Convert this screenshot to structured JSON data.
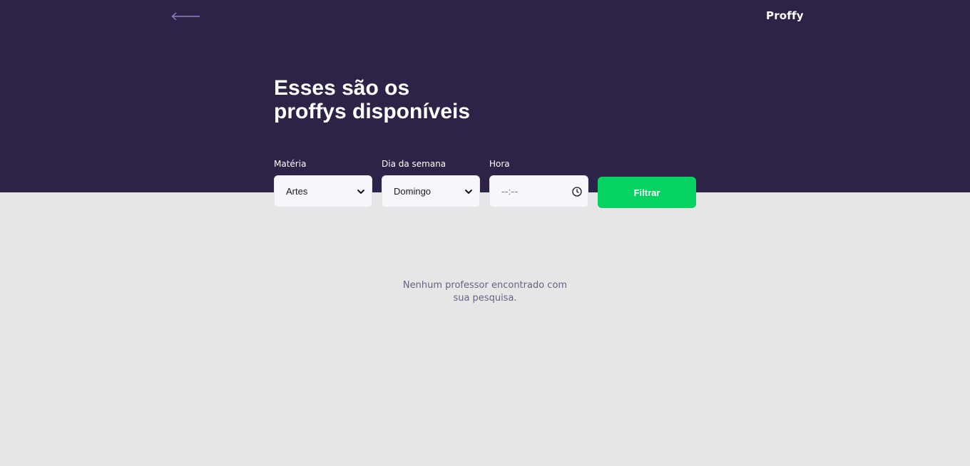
{
  "header": {
    "back_icon": "arrow-left-icon",
    "brand": "Proffy"
  },
  "hero": {
    "title_line1": "Esses são os",
    "title_line2": "proffys disponíveis"
  },
  "search": {
    "subject_label": "Matéria",
    "subject_value": "Artes",
    "weekday_label": "Dia da semana",
    "weekday_value": "Domingo",
    "time_label": "Hora",
    "time_placeholder": "--:--",
    "filter_label": "Filtrar"
  },
  "results": {
    "empty_line1": "Nenhum professor encontrado com",
    "empty_line2": "sua pesquisa."
  },
  "colors": {
    "hero_background": "#2d2347",
    "page_background": "#e6e6e6",
    "button_green": "#04d361",
    "muted_text": "#6a6180"
  }
}
